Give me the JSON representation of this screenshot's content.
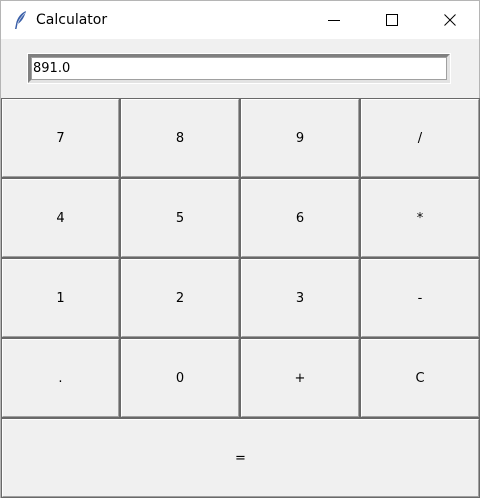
{
  "window": {
    "title": "Calculator"
  },
  "display": {
    "value": "891.0"
  },
  "keypad": {
    "row1": [
      "7",
      "8",
      "9",
      "/"
    ],
    "row2": [
      "4",
      "5",
      "6",
      "*"
    ],
    "row3": [
      "1",
      "2",
      "3",
      "-"
    ],
    "row4": [
      ".",
      "0",
      "+",
      "C"
    ],
    "equals": "="
  },
  "icons": {
    "app": "feather-icon",
    "minimize": "minimize-icon",
    "maximize": "maximize-icon",
    "close": "close-icon"
  }
}
